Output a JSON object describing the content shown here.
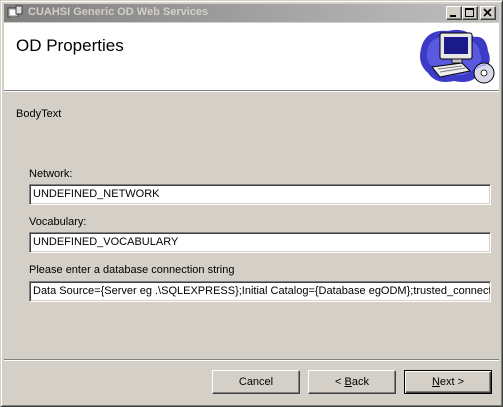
{
  "window": {
    "title": "CUAHSI Generic OD Web Services"
  },
  "banner": {
    "title": "OD Properties",
    "graphic_icon": "computer-with-cd-icon"
  },
  "body_text": "BodyText",
  "fields": {
    "network": {
      "label": "Network:",
      "value": "UNDEFINED_NETWORK"
    },
    "vocabulary": {
      "label": "Vocabulary:",
      "value": "UNDEFINED_VOCABULARY"
    },
    "connection": {
      "label": "Please enter a database connection string",
      "value": "Data Source={Server eg .\\SQLEXPRESS};Initial Catalog={Database egODM};trusted_connection=true"
    }
  },
  "buttons": {
    "cancel": "Cancel",
    "back_mnemonic": "B",
    "back_rest": "ack",
    "back_prefix": "< ",
    "next_mnemonic": "N",
    "next_rest": "ext >"
  },
  "colors": {
    "titlebar_start": "#808080",
    "titlebar_end": "#c0c0c0",
    "face": "#d4d0c8"
  }
}
